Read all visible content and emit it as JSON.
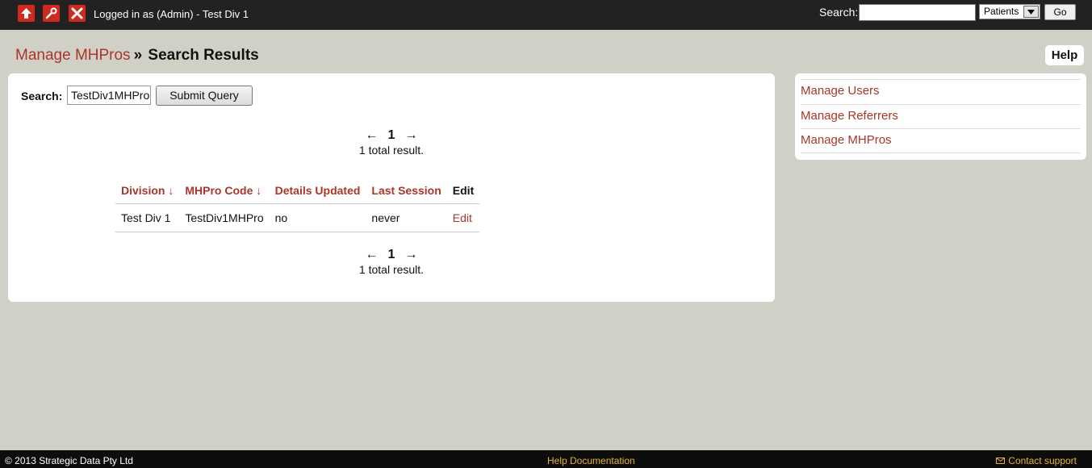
{
  "topbar": {
    "icons": [
      "home-up-icon",
      "wrench-icon",
      "close-icon"
    ],
    "login_text": "Logged in as (Admin) - Test Div 1",
    "search_label": "Search:",
    "search_value": "",
    "select_value": "Patients",
    "go_label": "Go"
  },
  "breadcrumb": {
    "parent": "Manage MHPros",
    "separator": "»",
    "current": "Search Results"
  },
  "help_label": "Help",
  "main": {
    "search_label": "Search:",
    "search_value": "TestDiv1MHPro",
    "submit_label": "Submit Query",
    "pager": {
      "prev": "←",
      "page": "1",
      "next": "→",
      "total": "1 total result."
    },
    "table": {
      "headers": [
        "Division ↓",
        "MHPro Code ↓",
        "Details Updated",
        "Last Session",
        "Edit"
      ],
      "rows": [
        [
          "Test Div 1",
          "TestDiv1MHPro",
          "no",
          "never",
          "Edit"
        ]
      ]
    }
  },
  "sidebar": {
    "items": [
      {
        "label": "Manage Users"
      },
      {
        "label": "Manage Referrers"
      },
      {
        "label": "Manage MHPros"
      }
    ]
  },
  "footer": {
    "copyright": "© 2013 Strategic Data Pty Ltd",
    "help_doc": "Help Documentation",
    "contact": "Contact support"
  },
  "colors": {
    "accent": "#a8362a",
    "topbar_bg": "#222222",
    "page_bg": "#d1d0c7",
    "footer_link": "#e5b334",
    "icon_red": "#d02a1e"
  }
}
